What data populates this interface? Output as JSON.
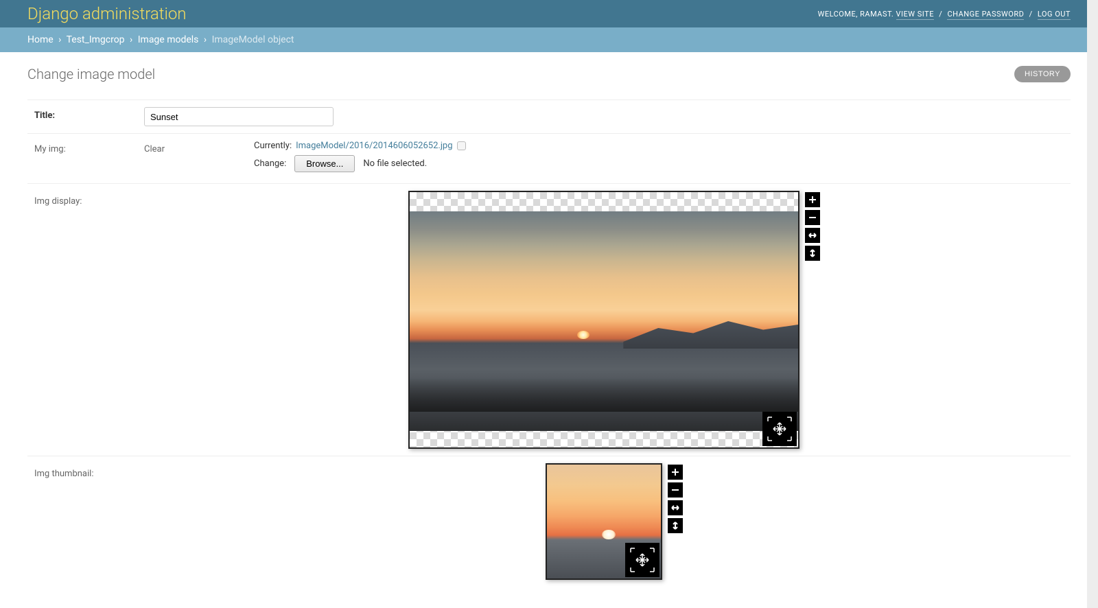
{
  "header": {
    "branding": "Django administration",
    "welcome_prefix": "WELCOME, ",
    "username": "RAMAST",
    "view_site": "VIEW SITE",
    "change_password": "CHANGE PASSWORD",
    "log_out": "LOG OUT"
  },
  "breadcrumbs": {
    "home": "Home",
    "app": "Test_Imgcrop",
    "model": "Image models",
    "current": "ImageModel object"
  },
  "page": {
    "title": "Change image model",
    "history_btn": "HISTORY"
  },
  "form": {
    "title_label": "Title:",
    "title_value": "Sunset",
    "myimg_label": "My img:",
    "clear_label": "Clear",
    "currently_label": "Currently:",
    "current_file": "ImageModel/2016/2014606052652.jpg",
    "change_label": "Change:",
    "browse_btn": "Browse...",
    "no_file": "No file selected.",
    "img_display_label": "Img display:",
    "img_thumbnail_label": "Img thumbnail:"
  }
}
